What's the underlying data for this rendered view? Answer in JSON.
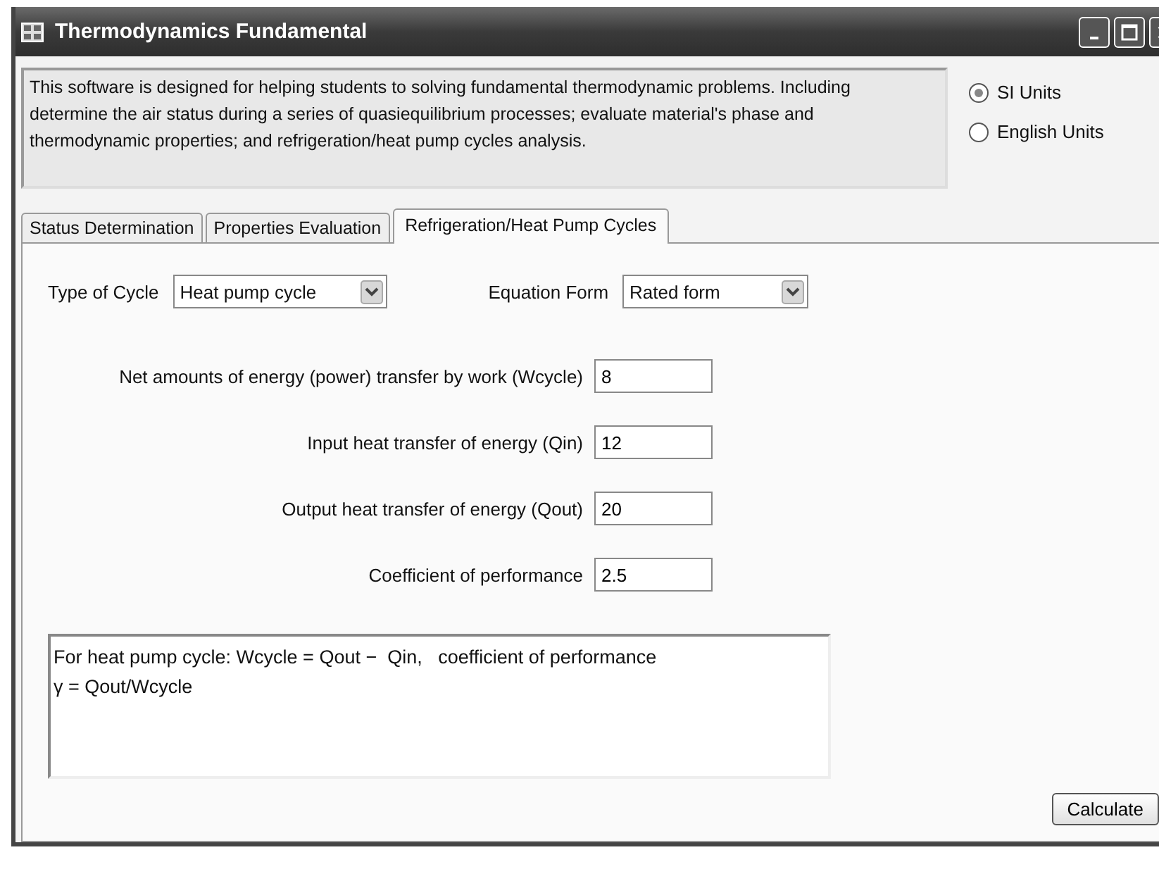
{
  "window": {
    "title": "Thermodynamics Fundamental"
  },
  "description": "This software is designed for helping students to solving fundamental thermodynamic problems. Including determine the air status during a series of quasiequilibrium processes; evaluate material's phase and thermodynamic properties; and refrigeration/heat pump cycles analysis.",
  "units": [
    {
      "label": "SI Units",
      "selected": true
    },
    {
      "label": "English Units",
      "selected": false
    }
  ],
  "tabs": [
    {
      "label": "Status Determination",
      "selected": false
    },
    {
      "label": "Properties Evaluation",
      "selected": false
    },
    {
      "label": "Refrigeration/Heat Pump Cycles",
      "selected": true
    }
  ],
  "type_of_cycle": {
    "label": "Type of Cycle",
    "value": "Heat pump cycle"
  },
  "equation_form": {
    "label": "Equation Form",
    "value": "Rated form"
  },
  "fields": [
    {
      "label": "Net amounts of energy (power) transfer by work (Wcycle)",
      "value": "8"
    },
    {
      "label": "Input heat transfer of energy (Qin)",
      "value": "12"
    },
    {
      "label": "Output heat transfer of energy (Qout)",
      "value": "20"
    },
    {
      "label": "Coefficient of performance",
      "value": "2.5"
    }
  ],
  "result_text": "For heat pump cycle: Wcycle = Qout −  Qin,   coefficient of performance\nγ = Qout/Wcycle",
  "buttons": [
    "Calculate"
  ]
}
